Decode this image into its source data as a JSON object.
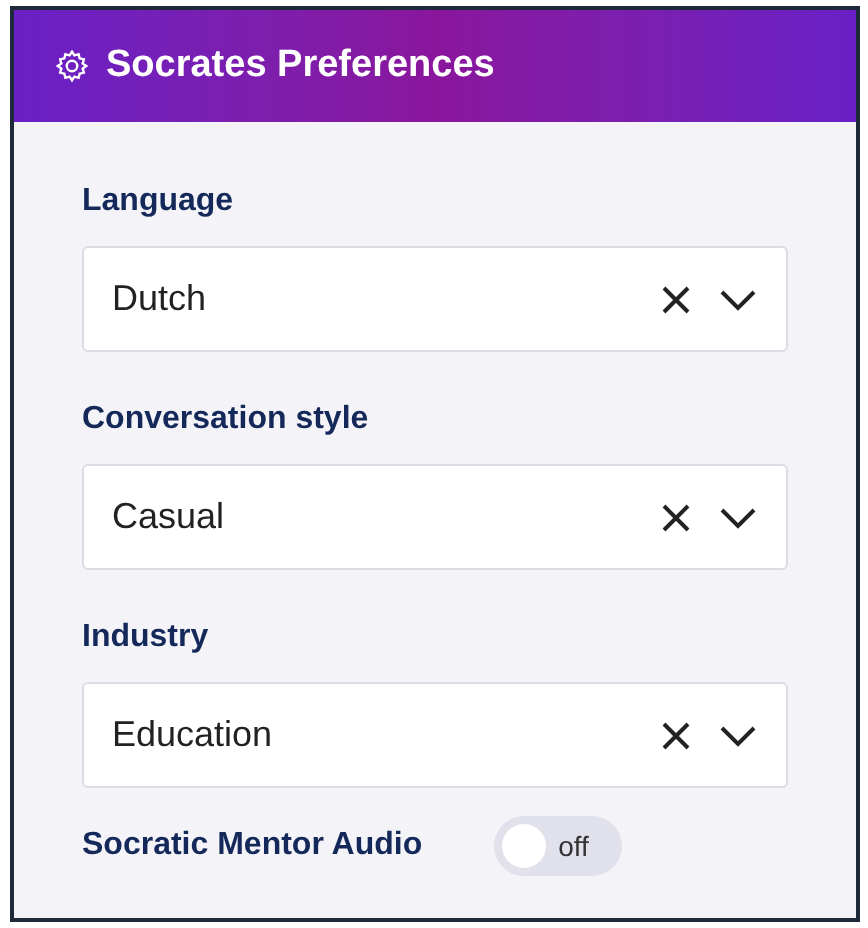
{
  "window": {
    "title": "Socrates Preferences"
  },
  "fields": [
    {
      "label": "Language",
      "value": "Dutch"
    },
    {
      "label": "Conversation style",
      "value": "Casual"
    },
    {
      "label": "Industry",
      "value": "Education"
    }
  ],
  "audio_toggle": {
    "label": "Socratic Mentor Audio",
    "on": false,
    "state_text": "off"
  }
}
